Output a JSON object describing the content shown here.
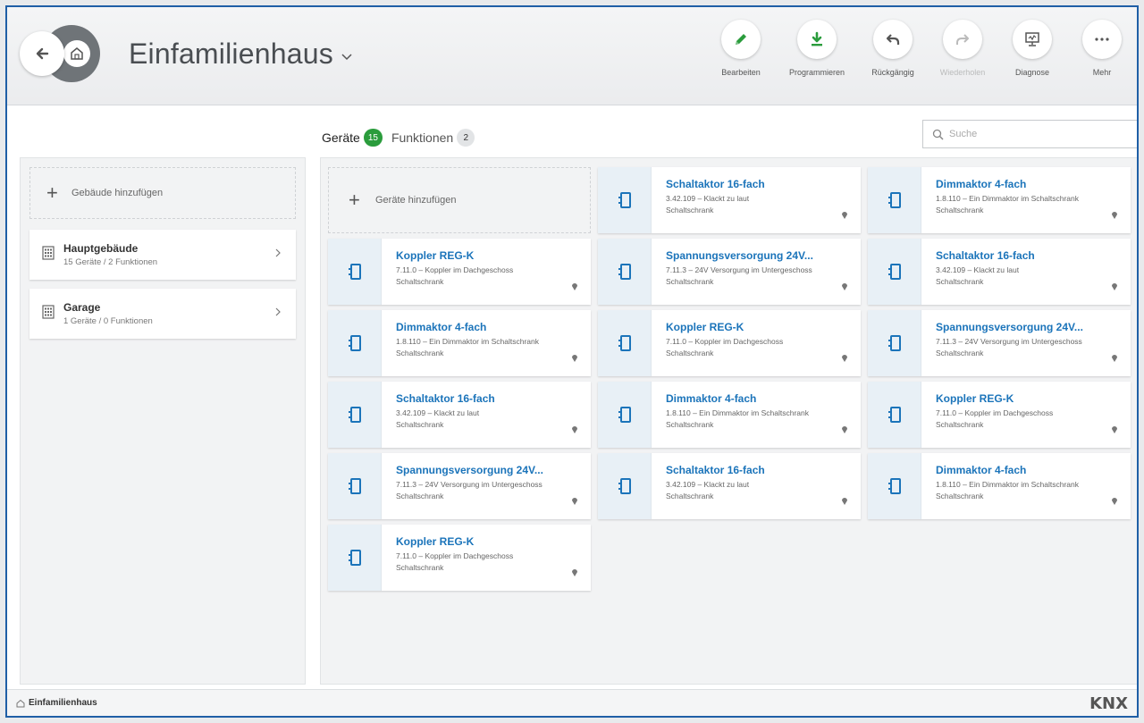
{
  "header": {
    "title": "Einfamilienhaus",
    "toolbar": [
      {
        "label": "Bearbeiten",
        "icon": "pencil-icon",
        "color": "#2a9c3c",
        "disabled": false
      },
      {
        "label": "Programmieren",
        "icon": "download-icon",
        "color": "#2a9c3c",
        "disabled": false
      },
      {
        "label": "Rückgängig",
        "icon": "undo-icon",
        "color": "#555555",
        "disabled": false
      },
      {
        "label": "Wiederholen",
        "icon": "redo-icon",
        "color": "#bbbbbb",
        "disabled": true
      },
      {
        "label": "Diagnose",
        "icon": "monitor-icon",
        "color": "#555555",
        "disabled": false
      },
      {
        "label": "Mehr",
        "icon": "more-icon",
        "color": "#555555",
        "disabled": false
      }
    ]
  },
  "tabs": [
    {
      "label": "Geräte",
      "count": "15",
      "active": true
    },
    {
      "label": "Funktionen",
      "count": "2",
      "active": false
    }
  ],
  "search": {
    "placeholder": "Suche"
  },
  "buildings": {
    "add_label": "Gebäude hinzufügen",
    "items": [
      {
        "name": "Hauptgebäude",
        "info": "15 Geräte  /  2 Funktionen"
      },
      {
        "name": "Garage",
        "info": "1 Geräte  /  0 Funktionen"
      }
    ]
  },
  "devices": {
    "add_label": "Geräte hinzufügen",
    "items": [
      {
        "name": "Schaltaktor 16-fach",
        "address": "3.42.109 – Klackt zu laut",
        "location": "Schaltschrank"
      },
      {
        "name": "Dimmaktor 4-fach",
        "address": "1.8.110 – Ein Dimmaktor im Schaltschrank",
        "location": "Schaltschrank"
      },
      {
        "name": "Koppler REG-K",
        "address": "7.11.0 – Koppler im Dachgeschoss",
        "location": "Schaltschrank"
      },
      {
        "name": "Spannungsversorgung 24V...",
        "address": "7.11.3 – 24V Versorgung im Untergeschoss",
        "location": "Schaltschrank"
      },
      {
        "name": "Schaltaktor 16-fach",
        "address": "3.42.109 – Klackt zu laut",
        "location": "Schaltschrank"
      },
      {
        "name": "Dimmaktor 4-fach",
        "address": "1.8.110 – Ein Dimmaktor im Schaltschrank",
        "location": "Schaltschrank"
      },
      {
        "name": "Koppler REG-K",
        "address": "7.11.0 – Koppler im Dachgeschoss",
        "location": "Schaltschrank"
      },
      {
        "name": "Spannungsversorgung 24V...",
        "address": "7.11.3 – 24V Versorgung im Untergeschoss",
        "location": "Schaltschrank"
      },
      {
        "name": "Schaltaktor 16-fach",
        "address": "3.42.109 – Klackt zu laut",
        "location": "Schaltschrank"
      },
      {
        "name": "Dimmaktor 4-fach",
        "address": "1.8.110 – Ein Dimmaktor im Schaltschrank",
        "location": "Schaltschrank"
      },
      {
        "name": "Koppler REG-K",
        "address": "7.11.0 – Koppler im Dachgeschoss",
        "location": "Schaltschrank"
      },
      {
        "name": "Spannungsversorgung 24V...",
        "address": "7.11.3 – 24V Versorgung im Untergeschoss",
        "location": "Schaltschrank"
      },
      {
        "name": "Schaltaktor 16-fach",
        "address": "3.42.109 – Klackt zu laut",
        "location": "Schaltschrank"
      },
      {
        "name": "Dimmaktor 4-fach",
        "address": "1.8.110 – Ein Dimmaktor im Schaltschrank",
        "location": "Schaltschrank"
      },
      {
        "name": "Koppler REG-K",
        "address": "7.11.0 – Koppler im Dachgeschoss",
        "location": "Schaltschrank"
      }
    ]
  },
  "statusbar": {
    "project": "Einfamilienhaus",
    "logo": "KNX"
  },
  "colors": {
    "accent": "#1b74ba",
    "green": "#2a9c3c",
    "frame": "#1f5fa6"
  }
}
